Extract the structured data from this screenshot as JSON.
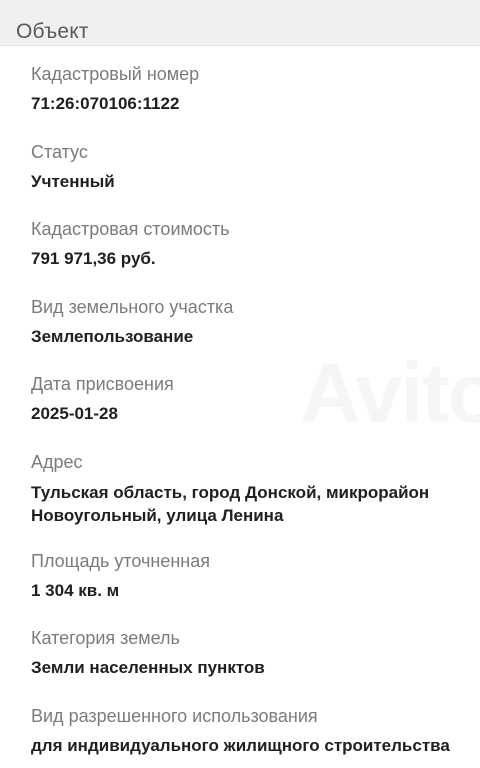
{
  "section": {
    "title": "Объект"
  },
  "watermark": "Avito",
  "fields": {
    "cadastral_number": {
      "label": "Кадастровый номер",
      "value": "71:26:070106:1122"
    },
    "status": {
      "label": "Статус",
      "value": "Учтенный"
    },
    "cadastral_cost": {
      "label": "Кадастровая стоимость",
      "value": "791 971,36 руб."
    },
    "land_type": {
      "label": "Вид земельного участка",
      "value": "Землепользование"
    },
    "assignment_date": {
      "label": "Дата присвоения",
      "value": "2025-01-28"
    },
    "address": {
      "label": "Адрес",
      "value": "Тульская область, город Донской, микрорайон Новоугольный, улица Ленина"
    },
    "area": {
      "label": "Площадь уточненная",
      "value": "1 304 кв. м"
    },
    "land_category": {
      "label": "Категория земель",
      "value": "Земли населенных пунктов"
    },
    "permitted_use": {
      "label": "Вид разрешенного использования",
      "value": "для индивидуального жилищного строительства"
    }
  }
}
